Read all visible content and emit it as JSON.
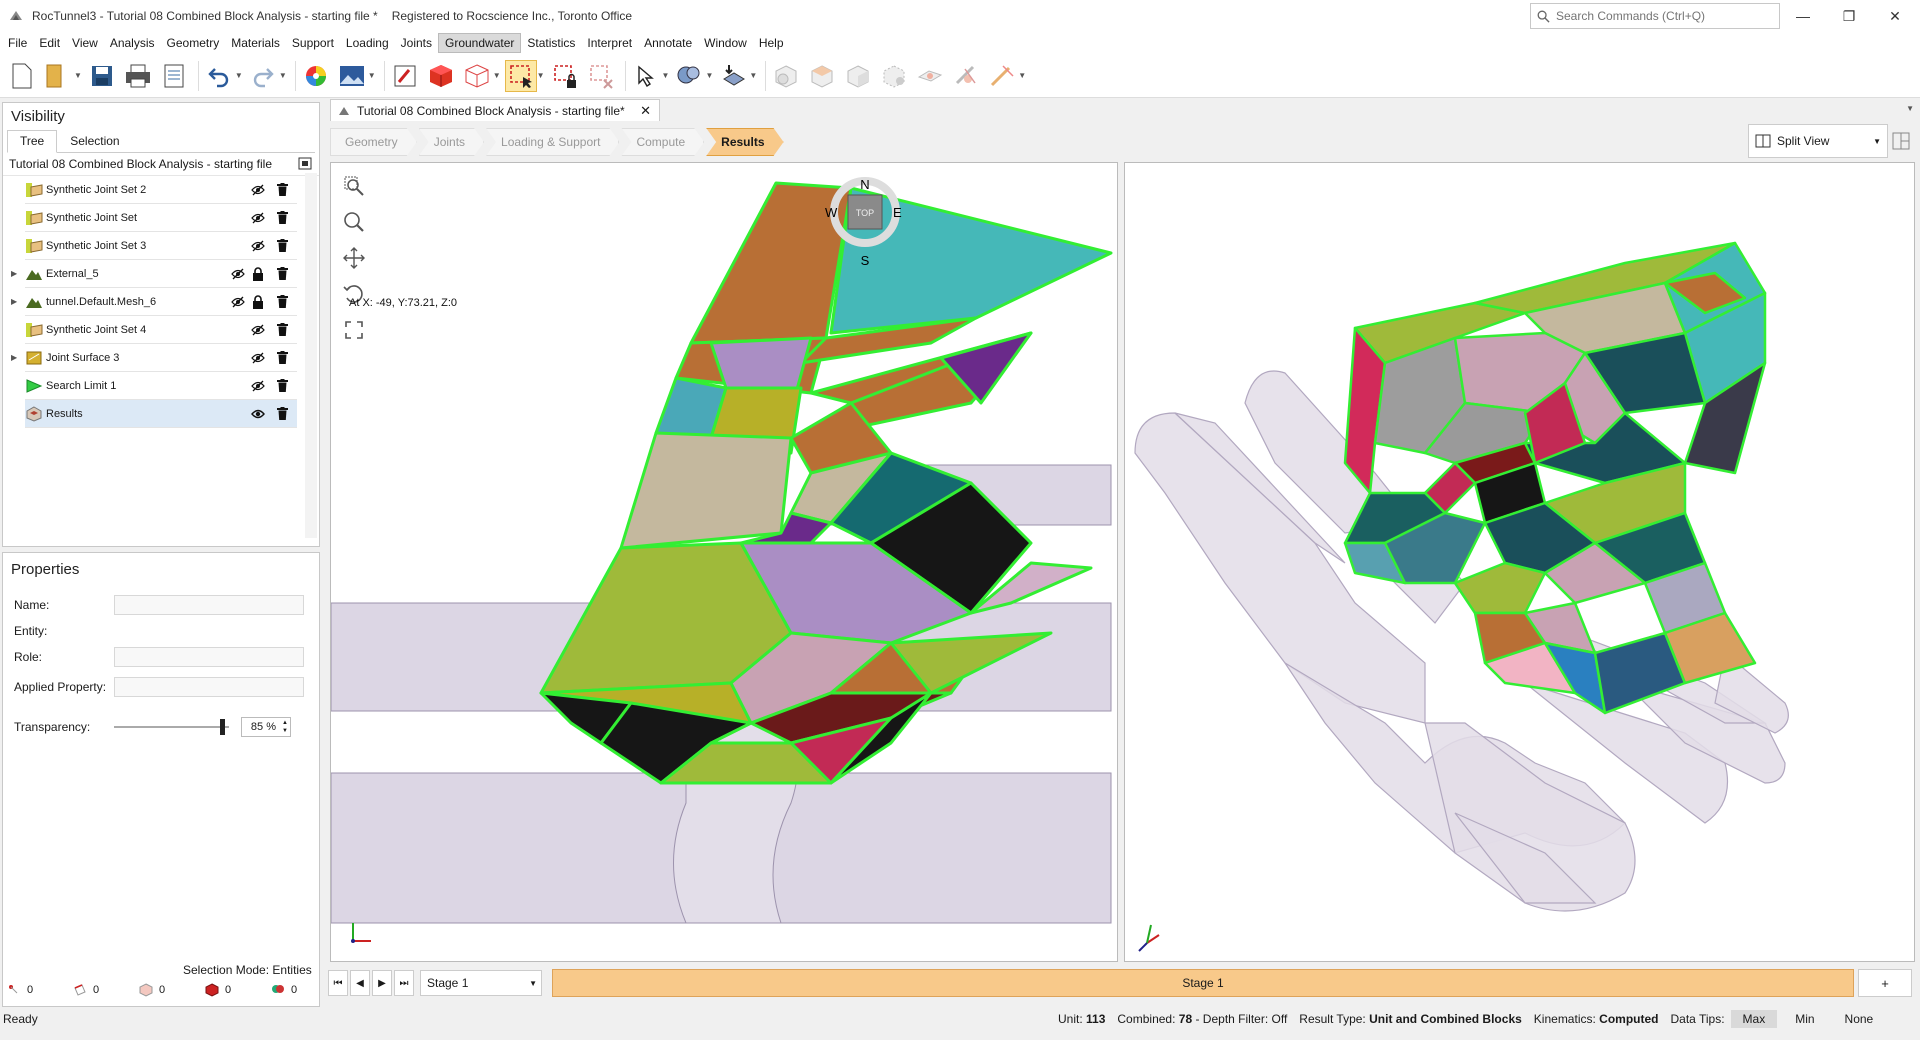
{
  "window": {
    "title": "RocTunnel3 - Tutorial 08 Combined Block Analysis - starting file *",
    "registration": "Registered to Rocscience Inc., Toronto Office",
    "search_placeholder": "Search Commands (Ctrl+Q)"
  },
  "menu": {
    "items": [
      "File",
      "Edit",
      "View",
      "Analysis",
      "Geometry",
      "Materials",
      "Support",
      "Loading",
      "Joints",
      "Groundwater",
      "Statistics",
      "Interpret",
      "Annotate",
      "Window",
      "Help"
    ],
    "active": "Groundwater"
  },
  "visibility": {
    "title": "Visibility",
    "tabs": [
      "Tree",
      "Selection"
    ],
    "tree_title": "Tutorial 08 Combined Block Analysis - starting file",
    "items": [
      {
        "label": "Synthetic Joint Set 2",
        "icon": "joint-set-icon",
        "color": "#c8d63a"
      },
      {
        "label": "Synthetic Joint Set",
        "icon": "joint-set-icon",
        "color": "#c8d63a"
      },
      {
        "label": "Synthetic Joint Set 3",
        "icon": "joint-set-icon",
        "color": "#c8d63a"
      },
      {
        "label": "External_5",
        "icon": "mesh-icon",
        "color": "#4a6a20"
      },
      {
        "label": "tunnel.Default.Mesh_6",
        "icon": "mesh-icon",
        "color": "#4a6a20"
      },
      {
        "label": "Synthetic Joint Set 4",
        "icon": "joint-set-icon",
        "color": "#c8d63a"
      },
      {
        "label": "Joint Surface 3",
        "icon": "joint-surface-icon",
        "color": "#d4b030"
      },
      {
        "label": "Search Limit 1",
        "icon": "search-limit-icon",
        "color": "#33cc44"
      },
      {
        "label": "Results",
        "icon": "results-icon",
        "color": "#b04030"
      }
    ]
  },
  "properties": {
    "title": "Properties",
    "name_label": "Name:",
    "entity_label": "Entity:",
    "role_label": "Role:",
    "applied_label": "Applied Property:",
    "transparency_label": "Transparency:",
    "transparency_value": "85 %",
    "transparency_level": 0.85,
    "selection_mode": "Selection Mode: Entities",
    "counts": [
      "0",
      "0",
      "0",
      "0",
      "0"
    ]
  },
  "document": {
    "tab_title": "Tutorial 08 Combined Block Analysis - starting file*",
    "workflow": [
      "Geometry",
      "Joints",
      "Loading & Support",
      "Compute",
      "Results"
    ],
    "active_step": "Results",
    "view_mode": "Split View"
  },
  "viewport_left": {
    "compass": {
      "n": "N",
      "s": "S",
      "e": "E",
      "w": "W",
      "cube": "TOP"
    },
    "coordinate_readout": "At X: -49, Y:73.21, Z:0"
  },
  "stage": {
    "selected": "Stage 1",
    "strip_label": "Stage 1",
    "add_label": "+"
  },
  "status": {
    "ready": "Ready",
    "unit_label": "Unit:",
    "unit_value": "113",
    "combined_label": "Combined:",
    "combined_value": "78",
    "depth_filter": "- Depth Filter: Off",
    "result_type_label": "Result Type:",
    "result_type_value": "Unit and Combined Blocks",
    "kinematics_label": "Kinematics:",
    "kinematics_value": "Computed",
    "data_tips_label": "Data Tips:",
    "data_tips_options": [
      "Max",
      "Min",
      "None"
    ],
    "data_tips_active": "Max"
  },
  "colors": {
    "accent": "#f8c98a",
    "block_outline": "#33ee33",
    "tunnel": "#dcd6e4"
  }
}
